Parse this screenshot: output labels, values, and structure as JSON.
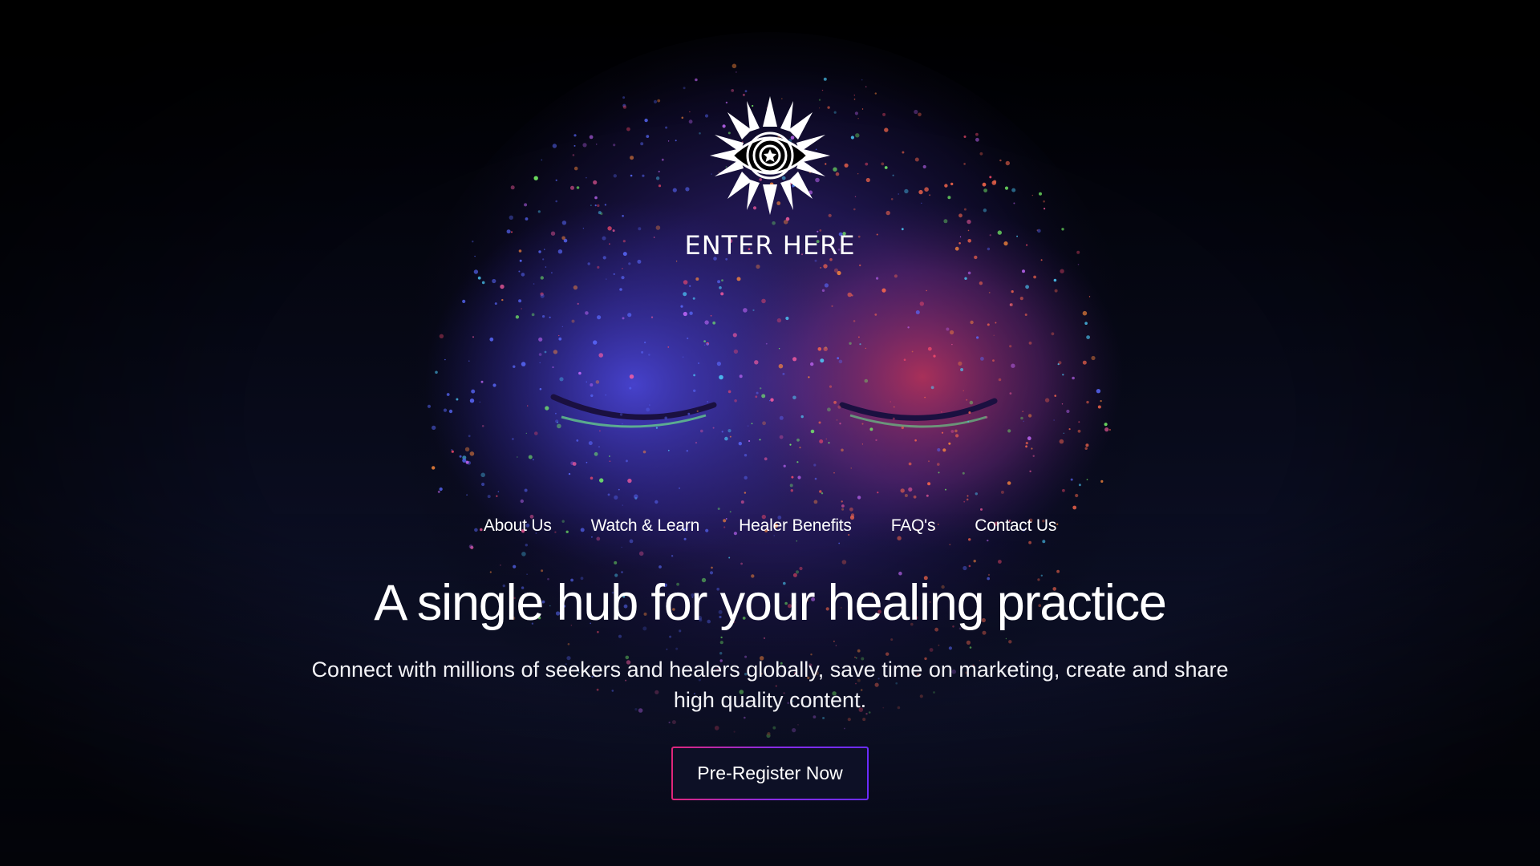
{
  "brand": {
    "logo_icon": "sun-eye-icon",
    "enter_label": "ENTER HERE"
  },
  "nav": {
    "items": [
      {
        "label": "About Us"
      },
      {
        "label": "Watch & Learn"
      },
      {
        "label": "Healer Benefits"
      },
      {
        "label": "FAQ's"
      },
      {
        "label": "Contact Us"
      }
    ]
  },
  "hero": {
    "headline": "A single hub for your healing practice",
    "subtext": "Connect with millions of seekers and healers globally, save time on marketing, create and share high quality content.",
    "cta_label": "Pre-Register Now"
  },
  "colors": {
    "background": "#0a0d1e",
    "cta_border_start": "#e0267a",
    "cta_border_end": "#6a2cff",
    "text": "#ffffff"
  }
}
